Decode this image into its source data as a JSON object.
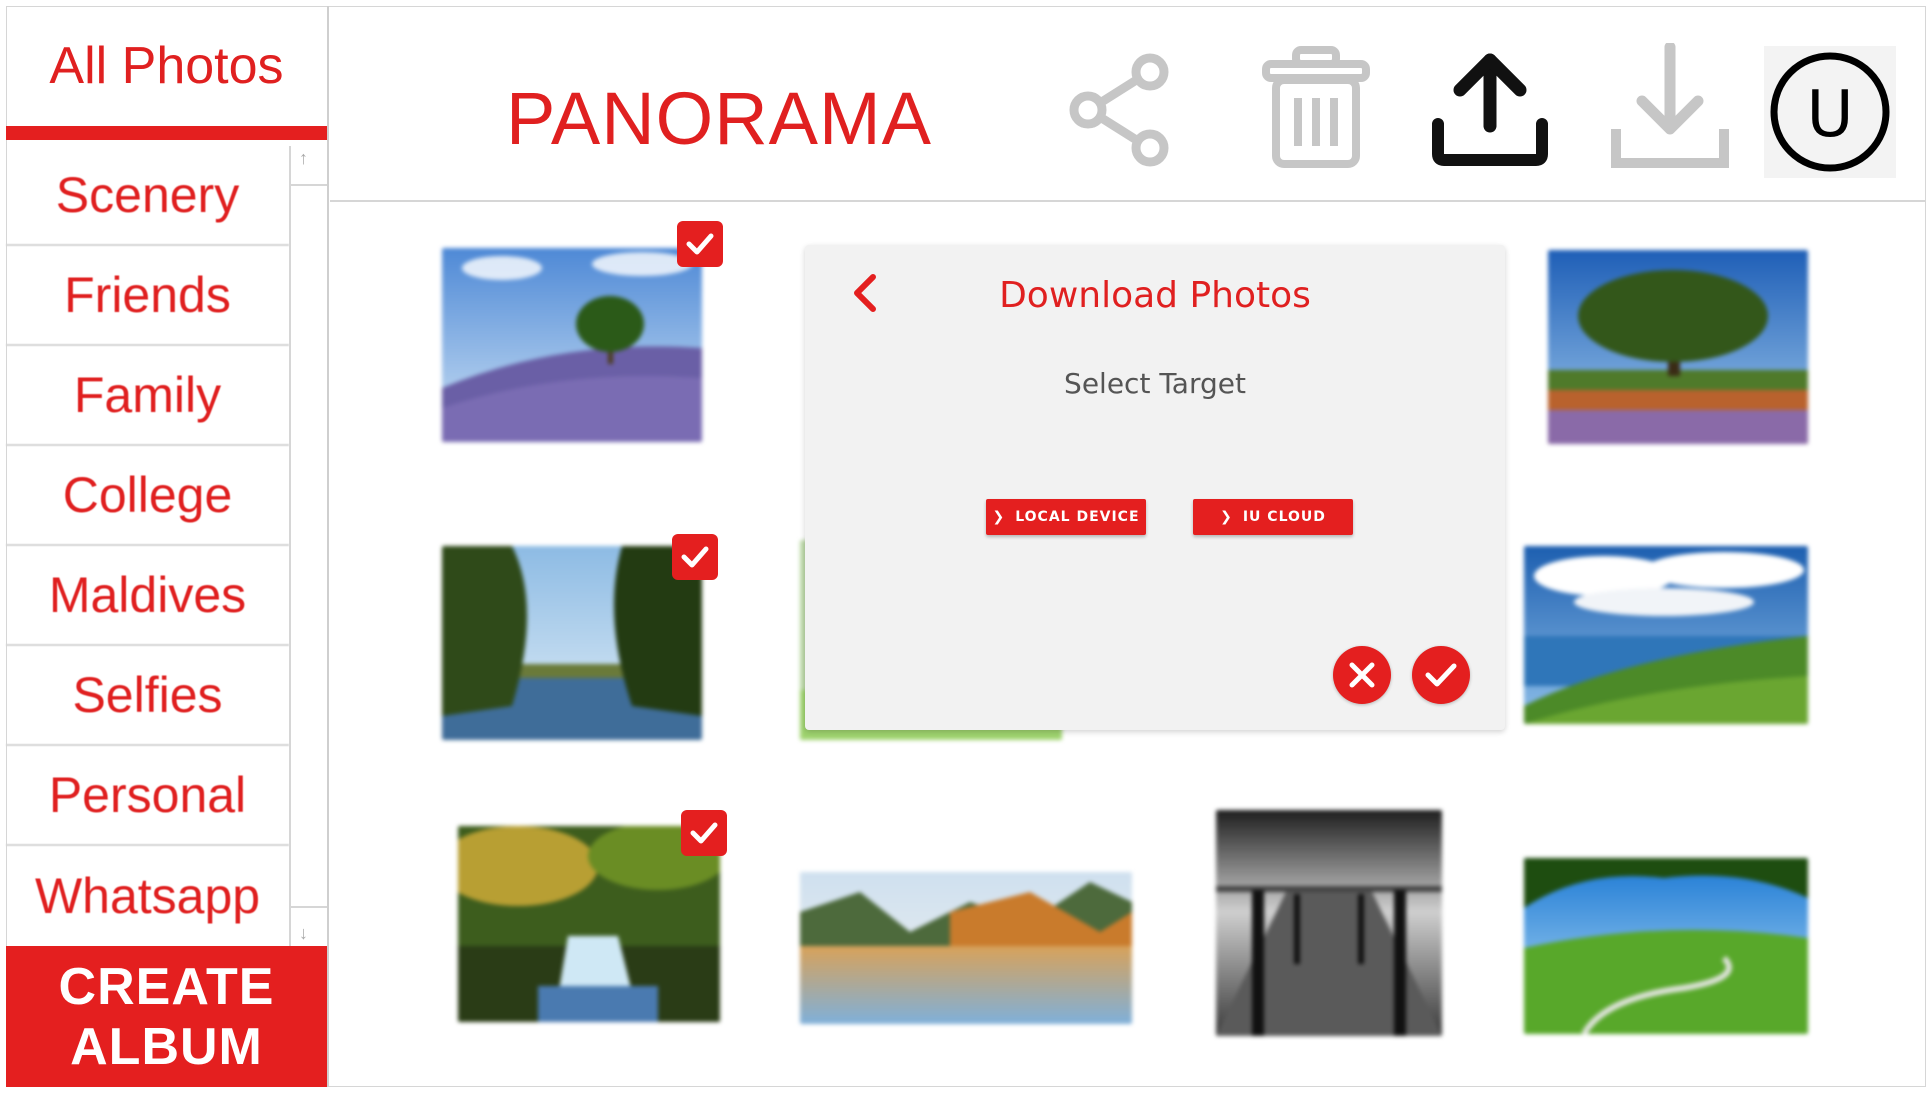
{
  "sidebar": {
    "all_photos_label": "All Photos",
    "albums": [
      "Scenery",
      "Friends",
      "Family",
      "College",
      "Maldives",
      "Selfies",
      "Personal",
      "Whatsapp"
    ],
    "create_album_line1": "CREATE",
    "create_album_line2": "ALBUM"
  },
  "header": {
    "title": "PANORAMA",
    "icons": [
      "share-icon",
      "trash-icon",
      "upload-icon",
      "download-icon",
      "user-icon"
    ],
    "user_initial": "U"
  },
  "dialog": {
    "title": "Download Photos",
    "subtitle": "Select Target",
    "option_local": "LOCAL DEVICE",
    "option_cloud": "IU CLOUD"
  },
  "colors": {
    "accent": "#e41f1f",
    "text_gray": "#555555"
  }
}
